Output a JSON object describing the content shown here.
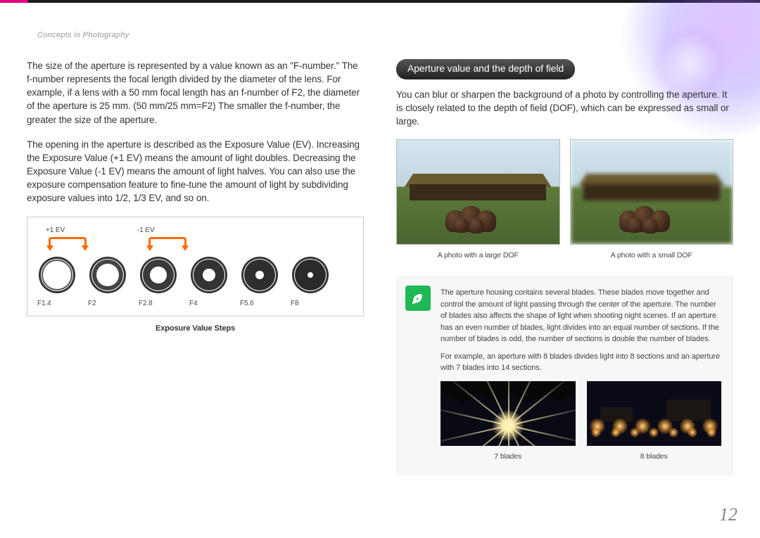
{
  "breadcrumb": "Concepts in Photography",
  "left": {
    "para1": "The size of the aperture is represented by a value known as an \"F-number.\" The f-number represents the focal length divided by the diameter of the lens. For example, if a lens with a 50 mm focal length has an f-number of F2, the diameter of the aperture is 25 mm. (50 mm/25 mm=F2) The smaller the f-number, the greater the size of the aperture.",
    "para2": "The opening in the aperture is described as the Exposure Value (EV). Increasing the Exposure Value (+1 EV) means the amount of light doubles. Decreasing the Exposure Value (-1 EV) means the amount of light halves. You can also use the exposure compensation feature to fine-tune the amount of light by subdividing exposure values into 1/2, 1/3 EV, and so on.",
    "ev_plus": "+1 EV",
    "ev_minus": "-1 EV",
    "ev_caption": "Exposure Value Steps",
    "f_stops": [
      "F1.4",
      "F2",
      "F2.8",
      "F4",
      "F5.6",
      "F8"
    ]
  },
  "right": {
    "heading": "Aperture value and the depth of field",
    "para1": "You can blur or sharpen the background of a photo by controlling the aperture. It is closely related to the depth of field (DOF), which can be expressed as small or large.",
    "photo1_caption": "A photo with a large DOF",
    "photo2_caption": "A photo with a small DOF",
    "tip_para1": "The aperture housing contains several blades. These blades move together and control the amount of light passing through the center of the aperture. The number of blades also affects the shape of light when shooting night scenes. If an aperture has an even number of blades, light divides into an equal number of sections. If the number of blades is odd, the number of sections is double the number of blades.",
    "tip_para2": "For example, an aperture with 8 blades divides light into 8 sections and an aperture with 7 blades into 14 sections.",
    "night1_caption": "7 blades",
    "night2_caption": "8 blades"
  },
  "page_number": "12",
  "chart_data": {
    "type": "table",
    "title": "Exposure Value Steps",
    "categories": [
      "F1.4",
      "F2",
      "F2.8",
      "F4",
      "F5.6",
      "F8"
    ],
    "annotations": [
      "+1 EV between F1.4 and F2",
      "-1 EV between F2.8 and F4"
    ]
  }
}
